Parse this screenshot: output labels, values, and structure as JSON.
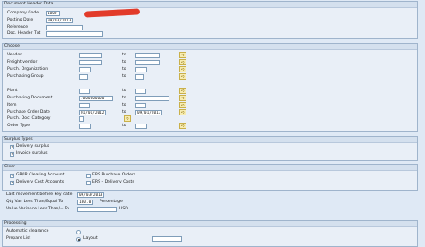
{
  "header": {
    "title": "Document Header Data",
    "company_code": {
      "label": "Company Code",
      "value": "1000"
    },
    "posting_date": {
      "label": "Posting Date",
      "value": "09/03/2013"
    },
    "reference": {
      "label": "Reference",
      "value": ""
    },
    "doc_header_txt": {
      "label": "Doc. Header Txt",
      "value": ""
    }
  },
  "choose": {
    "title": "Choose",
    "to_label": "to",
    "vendor": {
      "label": "Vendor",
      "from": "",
      "to": ""
    },
    "freight_vendor": {
      "label": "Freight vendor",
      "from": "",
      "to": ""
    },
    "purch_org": {
      "label": "Purch. Organization",
      "from": "",
      "to": ""
    },
    "purch_group": {
      "label": "Purchasing Group",
      "from": "",
      "to": ""
    },
    "plant": {
      "label": "Plant",
      "from": "",
      "to": ""
    },
    "purch_doc": {
      "label": "Purchasing Document",
      "from": "7000000020",
      "to": ""
    },
    "item": {
      "label": "Item",
      "from": "",
      "to": ""
    },
    "po_date": {
      "label": "Purchase Order Date",
      "from": "01/01/2012",
      "to": "09/01/2013"
    },
    "purch_doc_cat": {
      "label": "Purch. Doc. Category",
      "value": ""
    },
    "order_type": {
      "label": "Order Type",
      "from": "",
      "to": ""
    }
  },
  "surplus": {
    "title": "Surplus Types",
    "delivery": {
      "label": "Delivery surplus",
      "checked": true
    },
    "invoice": {
      "label": "Invoice surplus",
      "checked": true
    }
  },
  "clear": {
    "title": "Clear",
    "grir": {
      "label": "GR/IR Clearing Account",
      "checked": true
    },
    "ers_po": {
      "label": "ERS Purchase Orders",
      "checked": false
    },
    "delivery_cost": {
      "label": "Delivery Cost Accounts",
      "checked": true
    },
    "ers_dc": {
      "label": "ERS - Delivery Costs",
      "checked": false
    }
  },
  "misc": {
    "last_movement": {
      "label": "Last movement before key date",
      "value": "09/03/2013"
    },
    "qty_var": {
      "label": "Qty Var. Less Than/Equal To",
      "value": "100.0",
      "unit": "Percentage"
    },
    "value_var": {
      "label": "Value Variance Less Than/= To",
      "value": "",
      "unit": "USD"
    }
  },
  "processing": {
    "title": "Processing",
    "auto_clearance": {
      "label": "Automatic clearance",
      "selected": false
    },
    "prepare_list": {
      "label": "Prepare List",
      "selected": true
    },
    "layout_label": "Layout",
    "layout_value": ""
  },
  "colors": {
    "selection_button": "#f7ecb2",
    "redaction": "#e23b2a"
  },
  "icons": {
    "multiple_selection": "arrow-right-icon"
  }
}
